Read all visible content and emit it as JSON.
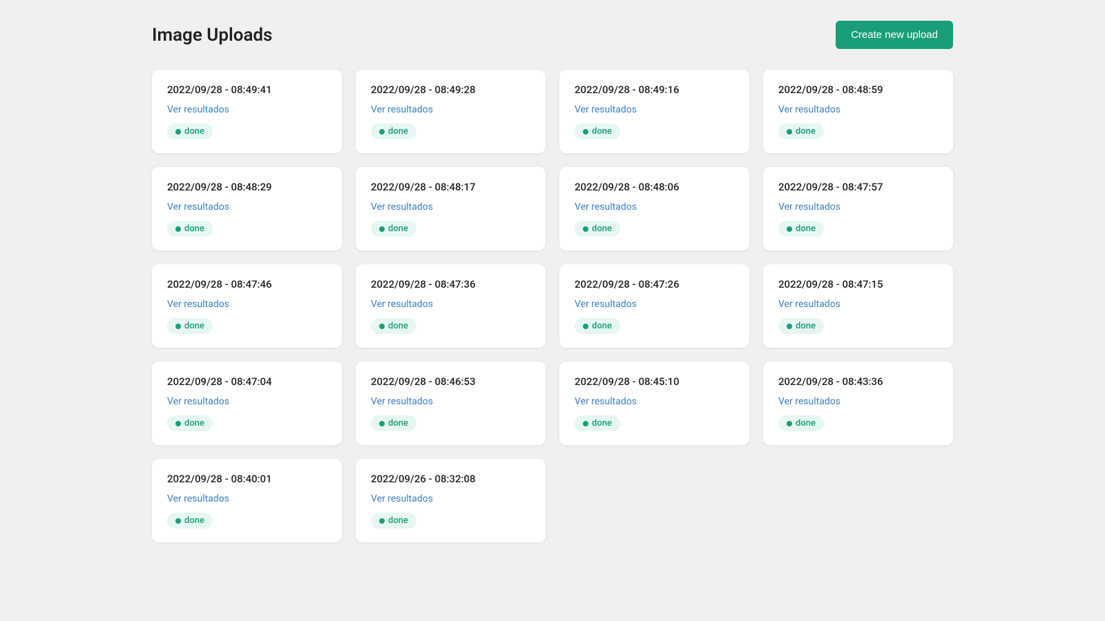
{
  "header": {
    "title": "Image Uploads",
    "create_button_label": "Create new upload"
  },
  "cards": [
    {
      "timestamp": "2022/09/28 - 08:49:41",
      "link_label": "Ver resultados",
      "status": "done"
    },
    {
      "timestamp": "2022/09/28 - 08:49:28",
      "link_label": "Ver resultados",
      "status": "done"
    },
    {
      "timestamp": "2022/09/28 - 08:49:16",
      "link_label": "Ver resultados",
      "status": "done"
    },
    {
      "timestamp": "2022/09/28 - 08:48:59",
      "link_label": "Ver resultados",
      "status": "done"
    },
    {
      "timestamp": "2022/09/28 - 08:48:29",
      "link_label": "Ver resultados",
      "status": "done"
    },
    {
      "timestamp": "2022/09/28 - 08:48:17",
      "link_label": "Ver resultados",
      "status": "done"
    },
    {
      "timestamp": "2022/09/28 - 08:48:06",
      "link_label": "Ver resultados",
      "status": "done"
    },
    {
      "timestamp": "2022/09/28 - 08:47:57",
      "link_label": "Ver resultados",
      "status": "done"
    },
    {
      "timestamp": "2022/09/28 - 08:47:46",
      "link_label": "Ver resultados",
      "status": "done"
    },
    {
      "timestamp": "2022/09/28 - 08:47:36",
      "link_label": "Ver resultados",
      "status": "done"
    },
    {
      "timestamp": "2022/09/28 - 08:47:26",
      "link_label": "Ver resultados",
      "status": "done"
    },
    {
      "timestamp": "2022/09/28 - 08:47:15",
      "link_label": "Ver resultados",
      "status": "done"
    },
    {
      "timestamp": "2022/09/28 - 08:47:04",
      "link_label": "Ver resultados",
      "status": "done"
    },
    {
      "timestamp": "2022/09/28 - 08:46:53",
      "link_label": "Ver resultados",
      "status": "done"
    },
    {
      "timestamp": "2022/09/28 - 08:45:10",
      "link_label": "Ver resultados",
      "status": "done"
    },
    {
      "timestamp": "2022/09/28 - 08:43:36",
      "link_label": "Ver resultados",
      "status": "done"
    },
    {
      "timestamp": "2022/09/28 - 08:40:01",
      "link_label": "Ver resultados",
      "status": "done"
    },
    {
      "timestamp": "2022/09/26 - 08:32:08",
      "link_label": "Ver resultados",
      "status": "done"
    }
  ],
  "status_dot_label": "●",
  "status_label": "done"
}
